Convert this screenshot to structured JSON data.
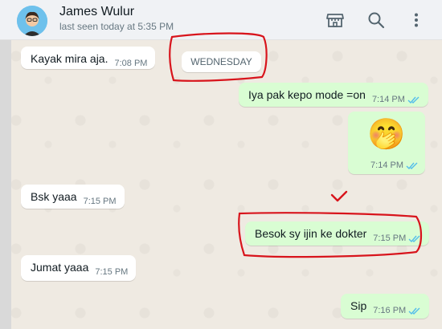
{
  "header": {
    "contact_name": "James Wulur",
    "contact_status": "last seen today at 5:35 PM",
    "icons": [
      "store-icon",
      "search-icon",
      "more-vert-icon"
    ]
  },
  "date_separator": "WEDNESDAY",
  "messages": [
    {
      "direction": "incoming",
      "text": "Kayak mira aja.",
      "time": "7:08 PM"
    },
    {
      "direction": "outgoing",
      "text": "Iya pak kepo mode =on",
      "time": "7:14 PM",
      "status": "read"
    },
    {
      "direction": "outgoing",
      "text": "🤭",
      "time": "7:14 PM",
      "status": "read"
    },
    {
      "direction": "incoming",
      "text": "Bsk yaaa",
      "time": "7:15 PM"
    },
    {
      "direction": "outgoing",
      "text": "Besok sy ijin ke dokter",
      "time": "7:15 PM",
      "status": "read"
    },
    {
      "direction": "incoming",
      "text": "Jumat yaaa",
      "time": "7:15 PM"
    },
    {
      "direction": "outgoing",
      "text": "Sip",
      "time": "7:16 PM",
      "status": "read"
    }
  ],
  "colors": {
    "incoming_bubble": "#ffffff",
    "outgoing_bubble": "#d9fdd3",
    "read_ticks": "#53bdeb",
    "annotation": "#d8141c"
  }
}
